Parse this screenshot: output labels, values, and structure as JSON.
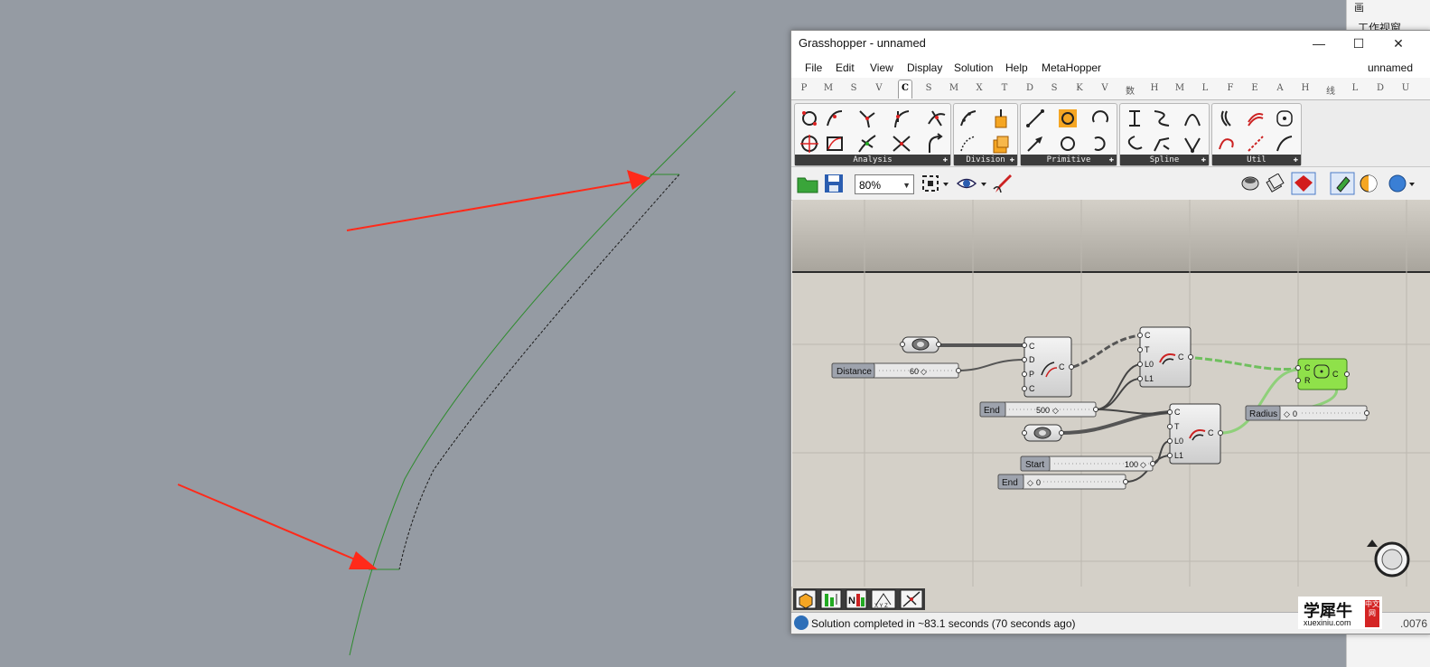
{
  "right_panel": {
    "tab_text": "画",
    "label": "工作视窗"
  },
  "window": {
    "title": "Grasshopper - unnamed",
    "minimize": "—",
    "maximize": "☐",
    "close": "✕"
  },
  "menu": {
    "items": [
      "File",
      "Edit",
      "View",
      "Display",
      "Solution",
      "Help",
      "MetaHopper"
    ],
    "doc_name": "unnamed"
  },
  "tabs": [
    "P",
    "M",
    "S",
    "V",
    "C",
    "S",
    "M",
    "X",
    "T",
    "D",
    "S",
    "K",
    "V",
    "数",
    "H",
    "M",
    "L",
    "F",
    "E",
    "A",
    "H",
    "线",
    "L",
    "D",
    "U"
  ],
  "active_tab_index": 4,
  "ribbon_panels": [
    "Analysis",
    "Division",
    "Primitive",
    "Spline",
    "Util"
  ],
  "toolbar": {
    "zoom": "80%"
  },
  "nodes": {
    "offset_inputs": [
      "C",
      "D",
      "P",
      "C"
    ],
    "offset_output": "C",
    "extend1_inputs": [
      "C",
      "T",
      "L0",
      "L1"
    ],
    "extend1_output": "C",
    "extend2_inputs": [
      "C",
      "T",
      "L0",
      "L1"
    ],
    "extend2_output": "C",
    "fillet_inputs": [
      "C",
      "R"
    ],
    "fillet_output": "C"
  },
  "sliders": {
    "distance": {
      "label": "Distance",
      "value": "60"
    },
    "end_top": {
      "label": "End",
      "value": "500"
    },
    "start": {
      "label": "Start",
      "value": "100"
    },
    "end_bottom": {
      "label": "End",
      "value": "0"
    },
    "radius": {
      "label": "Radius",
      "value": "0"
    }
  },
  "status": {
    "text": "Solution completed in ~83.1 seconds (70 seconds ago)",
    "number": ".0076"
  },
  "watermark": {
    "cn": "学犀牛",
    "url": "xuexiniu.com",
    "badge": "中文网"
  },
  "colors": {
    "viewport": "#959ba3",
    "canvas": "#d4d0c8",
    "curve_green": "#2e8b2e",
    "arrow_red": "#ff2a1a",
    "selected_node": "#8fe14a"
  }
}
